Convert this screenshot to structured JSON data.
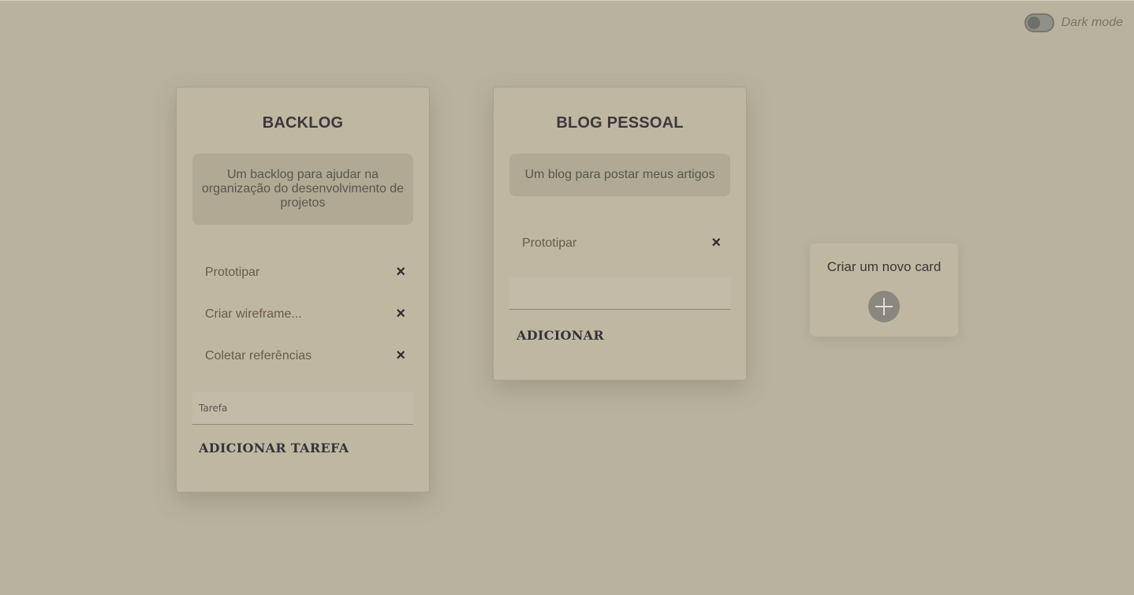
{
  "theme_toggle": {
    "label": "Dark mode",
    "enabled": false
  },
  "cards": [
    {
      "title": "BACKLOG",
      "description": "Um backlog para ajudar na organização do desenvolvimento de projetos",
      "tasks": [
        "Prototipar",
        "Criar wireframe...",
        "Coletar referências"
      ],
      "input_placeholder": "Tarefa",
      "input_value": "",
      "add_button": "ADICIONAR TAREFA"
    },
    {
      "title": "BLOG PESSOAL",
      "description": "Um blog para postar meus artigos",
      "tasks": [
        "Prototipar"
      ],
      "input_placeholder": "",
      "input_value": "",
      "add_button": "ADICIONAR"
    }
  ],
  "new_card": {
    "label": "Criar um novo card",
    "icon": "plus-icon"
  },
  "icons": {
    "remove": "×"
  },
  "colors": {
    "background": "#b9b29f",
    "card": "#c0b7a2",
    "text": "#3c383c"
  }
}
